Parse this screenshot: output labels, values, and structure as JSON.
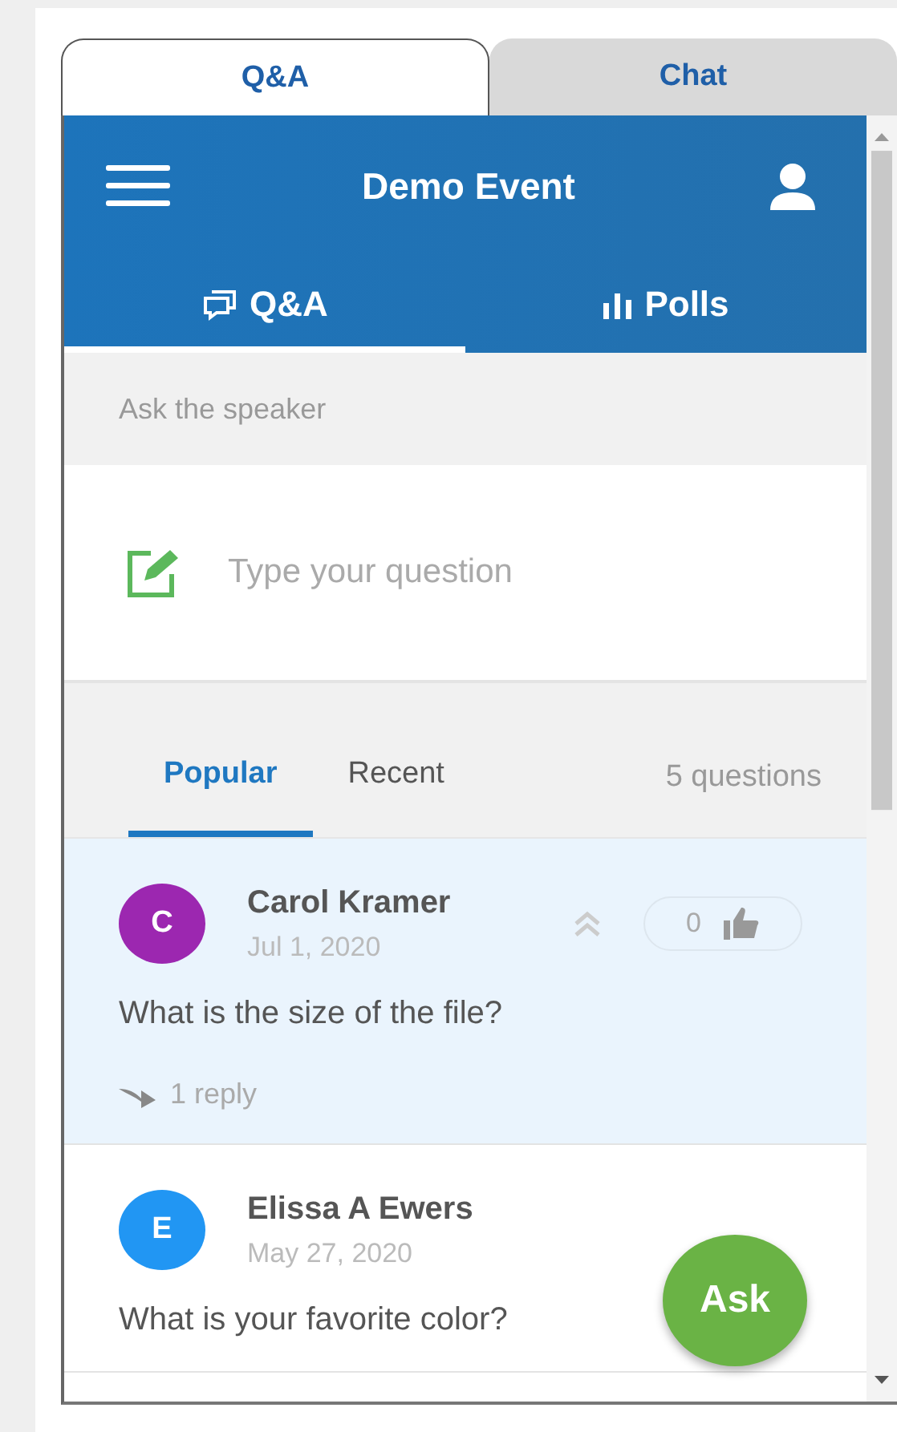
{
  "tabs": [
    {
      "label": "Q&A",
      "selected": true
    },
    {
      "label": "Chat",
      "selected": false
    }
  ],
  "header": {
    "title": "Demo Event"
  },
  "subtabs": [
    {
      "label": "Q&A",
      "kind": "qa",
      "selected": true
    },
    {
      "label": "Polls",
      "kind": "polls",
      "selected": false
    }
  ],
  "ask_section": {
    "label": "Ask the speaker",
    "placeholder": "Type your question"
  },
  "sort_tabs": [
    {
      "label": "Popular",
      "selected": true
    },
    {
      "label": "Recent",
      "selected": false
    }
  ],
  "question_count": "5 questions",
  "questions": [
    {
      "initial": "C",
      "color": "#9c27b0",
      "author": "Carol Kramer",
      "date": "Jul 1, 2020",
      "text": "What is the size of the file?",
      "votes": "0",
      "replies": "1 reply",
      "selected": true
    },
    {
      "initial": "E",
      "color": "#2196f3",
      "author": "Elissa A Ewers",
      "date": "May 27, 2020",
      "text": "What is your favorite color?",
      "selected": false
    }
  ],
  "ask_button": "Ask"
}
